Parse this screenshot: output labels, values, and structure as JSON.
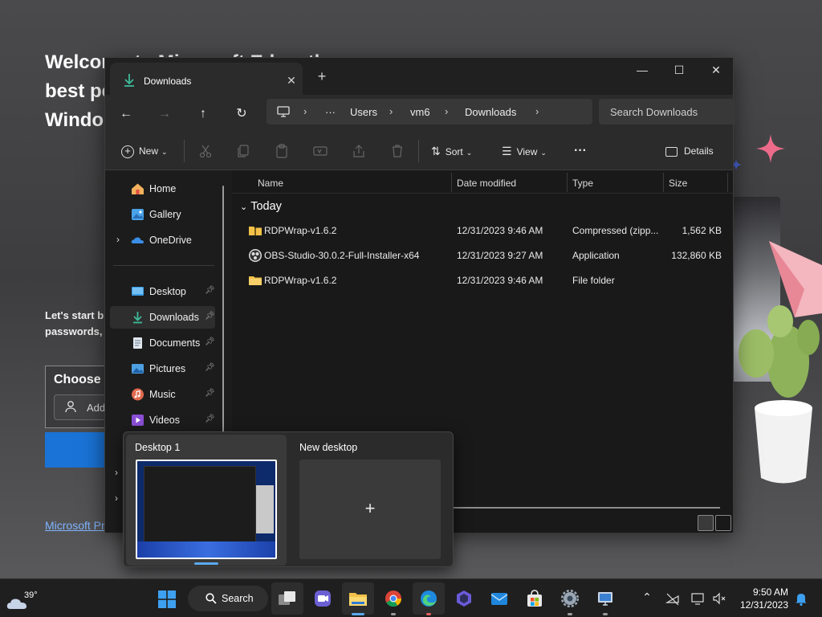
{
  "edge": {
    "heading": "Welcome to Microsoft Edge, the best performing browser on Windows",
    "heading_line1": "Welcome to Microsoft Edge, the",
    "heading_line2": "best pe",
    "heading_line3": "Windo",
    "sub_line1": "Let's start b",
    "sub_line2": "passwords,",
    "choose_title": "Choose a",
    "add_label": "Add",
    "privacy_link": "Microsoft Pr"
  },
  "explorer": {
    "tab_title": "Downloads",
    "window_controls": {
      "minimize": "—",
      "maximize": "☐",
      "close": "✕"
    },
    "breadcrumb": [
      "Users",
      "vm6",
      "Downloads"
    ],
    "breadcrumb_more": "···",
    "search_placeholder": "Search Downloads",
    "commands": {
      "new": "New",
      "sort": "Sort",
      "view": "View",
      "more": "···",
      "details": "Details"
    },
    "sidebar": {
      "top": [
        {
          "label": "Home",
          "icon": "home-icon"
        },
        {
          "label": "Gallery",
          "icon": "gallery-icon"
        },
        {
          "label": "OneDrive",
          "icon": "onedrive-icon"
        }
      ],
      "pinned": [
        {
          "label": "Desktop",
          "icon": "desktop-folder-icon"
        },
        {
          "label": "Downloads",
          "icon": "downloads-folder-icon",
          "selected": true
        },
        {
          "label": "Documents",
          "icon": "documents-folder-icon"
        },
        {
          "label": "Pictures",
          "icon": "pictures-folder-icon"
        },
        {
          "label": "Music",
          "icon": "music-folder-icon"
        },
        {
          "label": "Videos",
          "icon": "videos-folder-icon"
        }
      ]
    },
    "columns": [
      "Name",
      "Date modified",
      "Type",
      "Size"
    ],
    "group": "Today",
    "files": [
      {
        "name": "RDPWrap-v1.6.2",
        "date": "12/31/2023 9:46 AM",
        "type": "Compressed (zipp...",
        "size": "1,562 KB",
        "icon": "zip-folder-icon"
      },
      {
        "name": "OBS-Studio-30.0.2-Full-Installer-x64",
        "date": "12/31/2023 9:27 AM",
        "type": "Application",
        "size": "132,860 KB",
        "icon": "obs-app-icon"
      },
      {
        "name": "RDPWrap-v1.6.2",
        "date": "12/31/2023 9:46 AM",
        "type": "File folder",
        "size": "",
        "icon": "folder-icon"
      }
    ]
  },
  "taskview": {
    "desktop1": "Desktop 1",
    "new_desktop": "New desktop",
    "plus": "+"
  },
  "taskbar": {
    "temperature": "39°",
    "search_label": "Search",
    "time": "9:50 AM",
    "date": "12/31/2023",
    "apps": [
      "start",
      "search",
      "task-view",
      "teams",
      "file-explorer",
      "chrome",
      "edge",
      "copilot",
      "mail",
      "store",
      "settings",
      "remote-desktop"
    ]
  },
  "colors": {
    "accent": "#5aa8ee",
    "window_bg": "#1c1c1c",
    "toolbar_bg": "#2b2b2b",
    "folder": "#f3c14a",
    "edge_blue": "#1a73d6"
  }
}
